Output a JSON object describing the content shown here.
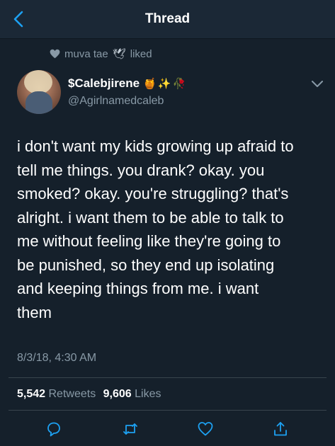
{
  "nav": {
    "title": "Thread"
  },
  "social_context": {
    "text": "muva tae",
    "emoji": "🕊",
    "action": "liked"
  },
  "author": {
    "display_name": "$Calebjirene",
    "emojis": "🍯✨🥀",
    "handle": "@Agirlnamedcaleb"
  },
  "tweet": {
    "lines": [
      "i don't want my kids growing up afraid to",
      "tell me things. you drank? okay. you",
      "smoked? okay. you're struggling? that's",
      "alright. i want them to be able to talk to",
      "me without feeling like they're going to",
      "be punished, so they end up isolating",
      "and keeping things from me. i want",
      "them"
    ],
    "timestamp": "8/3/18, 4:30 AM"
  },
  "stats": {
    "retweets_count": "5,542",
    "retweets_label": "Retweets",
    "likes_count": "9,606",
    "likes_label": "Likes"
  },
  "colors": {
    "background": "#15202b",
    "accent": "#1da1f2",
    "secondary_text": "#8899a6",
    "divider": "#38444d"
  },
  "icons": [
    "back-chevron-icon",
    "heart-icon",
    "dove-icon",
    "chevron-down-icon",
    "reply-icon",
    "retweet-icon",
    "like-icon",
    "share-icon"
  ]
}
